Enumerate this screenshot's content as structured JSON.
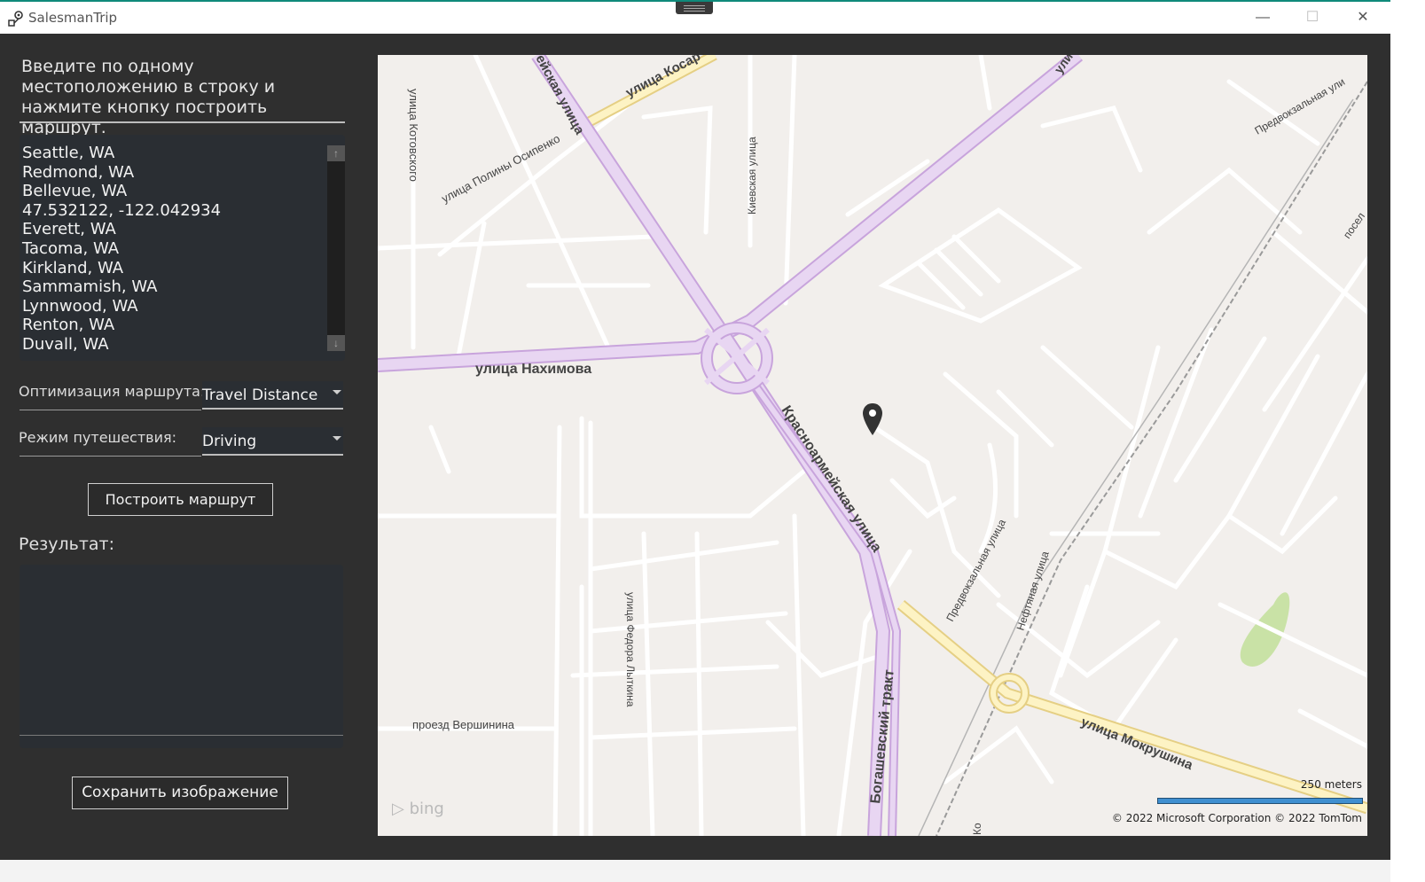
{
  "window": {
    "title": "SalesmanTrip",
    "minimize_glyph": "—",
    "maximize_glyph": "☐",
    "close_glyph": "✕"
  },
  "panel": {
    "instruction": "Введите по одному местоположению в строку и нажмите кнопку построить маршрут.",
    "locations": [
      "Seattle, WA",
      "Redmond, WA",
      "Bellevue, WA",
      "47.532122, -122.042934",
      "Everett, WA",
      "Tacoma, WA",
      "Kirkland, WA",
      "Sammamish, WA",
      "Lynnwood, WA",
      "Renton, WA",
      "Duvall, WA"
    ],
    "scroll_up_glyph": "↑",
    "scroll_down_glyph": "↓",
    "optimization_label": "Оптимизация маршрута:",
    "optimization_value": "Travel Distance",
    "travel_mode_label": "Режим путешествия:",
    "travel_mode_value": "Driving",
    "build_button": "Построить маршрут",
    "result_label": "Результат:",
    "save_button": "Сохранить изображение"
  },
  "map": {
    "streets": {
      "nakhimova": "улица Нахимова",
      "krasnoarmeyskaya": "Красноармейская улица",
      "krasnoarmeyskaya_top": "ейская улица",
      "kosarev": "улица Косар",
      "kotovskogo": "улица Котовского",
      "osipenko": "улица Полины Осипенко",
      "kievskaya": "Киевская улица",
      "predvokzalnaya": "Предвокзальная улица",
      "predvokzalnaya_top": "Предвокзальная ули",
      "neftyanaya": "Нефтяная улица",
      "lytkina": "улица Федора Лыткина",
      "vershinina": "проезд Вершинина",
      "bogashevsky": "Богашевский тракт",
      "mokrushina": "улица Мокрушина",
      "poselok": "посел",
      "uli_top": "ули",
      "ko_bottom": "Ко"
    },
    "scale": "250 meters",
    "copyright": "© 2022 Microsoft Corporation   © 2022 TomTom",
    "logo": "bing",
    "colors": {
      "background": "#f2efec",
      "minor_road": "#ffffff",
      "arterial": "#e8d6f2",
      "arterial_edge": "#c8a4dc",
      "highway": "#fdf3c4",
      "highway_edge": "#e5cf84",
      "park": "#c9e2a6",
      "pin": "#333333"
    }
  }
}
